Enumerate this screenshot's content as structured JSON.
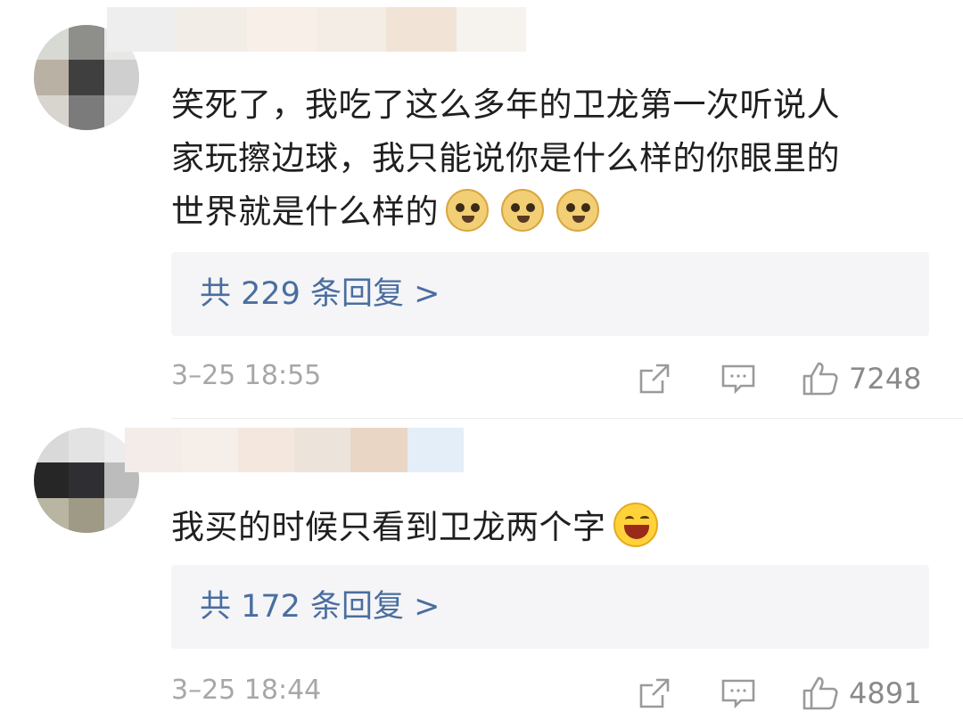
{
  "comments": [
    {
      "text_lines": [
        "笑死了，我吃了这么多年的卫龙第一次听说人",
        "家玩擦边球，我只能说你是什么样的你眼里的",
        "世界就是什么样的"
      ],
      "emoji": [
        "doge",
        "doge",
        "doge"
      ],
      "reply_link": "共 229 条回复 >",
      "date": "3–25 18:55",
      "like_count": "7248"
    },
    {
      "text_lines": [
        "我买的时候只看到卫龙两个字"
      ],
      "emoji": [
        "laugh"
      ],
      "reply_link": "共 172 条回复 >",
      "date": "3–25 18:44",
      "like_count": "4891"
    }
  ],
  "icons": {
    "share": "share-icon",
    "comment": "comment-icon",
    "like": "thumbs-up-icon"
  },
  "colors": {
    "link": "#4a6ea0",
    "reply_bg": "#f5f5f7",
    "meta_text": "#a7a7a7"
  }
}
